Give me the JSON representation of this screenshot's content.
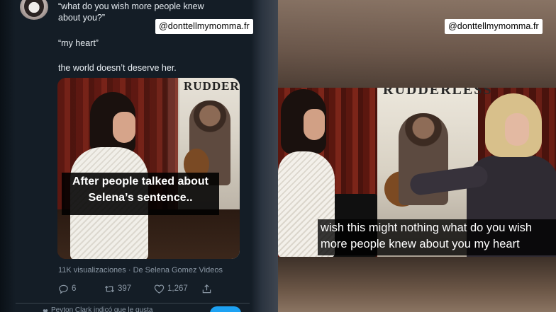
{
  "watermark": "@donttellmymomma.fr",
  "tweet": {
    "question_line1": "“what do you wish more people knew",
    "question_line2": "about you?”",
    "answer": "“my heart”",
    "comment": "the world doesn’t deserve her.",
    "video": {
      "poster_title": "RUDDER",
      "caption_line1": "After people talked about",
      "caption_line2": "Selena’s sentence.."
    },
    "views": "11K visualizaciones · De Selena Gomez Videos",
    "actions": {
      "replies": "6",
      "retweets": "397",
      "likes": "1,267"
    },
    "liked_by": "Peyton Clark indicó que le gusta"
  },
  "video_frame": {
    "poster_title": "RUDDERLESS",
    "subtitle_line1": "wish this might nothing what do you wish",
    "subtitle_line2": "more people knew about you my heart"
  },
  "icons": {
    "reply": "reply-icon",
    "retweet": "retweet-icon",
    "like": "heart-icon",
    "share": "share-icon",
    "liked": "heart-small-icon"
  },
  "colors": {
    "tweet_bg": "#141d26",
    "text_secondary": "#8b98a5",
    "twitter_blue": "#1da1f2"
  }
}
